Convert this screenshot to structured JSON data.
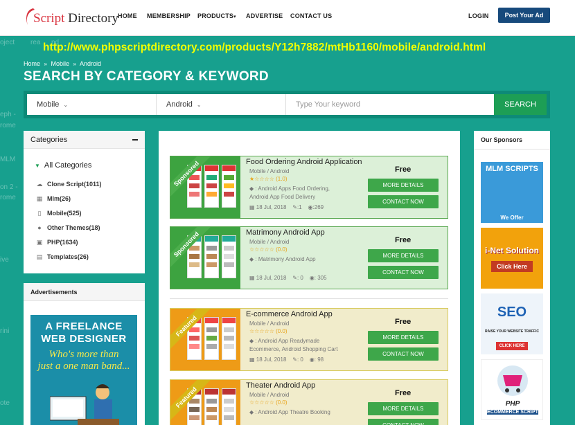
{
  "logo": {
    "brand": "Script",
    "brand_rest": " Directory"
  },
  "nav": {
    "home": "HOME",
    "membership": "MEMBERSHIP",
    "products": "PRODUCTS",
    "advertise": "ADVERTISE",
    "contact": "CONTACT US",
    "login": "LOGIN",
    "post_ad": "Post Your Ad"
  },
  "url": "http://www.phpscriptdirectory.com/products/Y12h7882/mtHb1160/mobile/android.html",
  "ghost": {
    "a": "oject",
    "b": "rea",
    "c": "nd",
    "d": "eph -",
    "e": "rome",
    "f": "MLM",
    "g": "on 2 -",
    "h": "rome",
    "i": "ive",
    "j": "rini",
    "k": "ote"
  },
  "breadcrumb": {
    "home": "Home",
    "mobile": "Mobile",
    "android": "Android"
  },
  "title": "SEARCH BY CATEGORY & KEYWORD",
  "search": {
    "category": "Mobile",
    "subcategory": "Android",
    "placeholder": "Type Your keyword",
    "button": "SEARCH"
  },
  "categories": {
    "heading": "Categories",
    "all": "All Categories",
    "items": [
      {
        "label": "Clone Script(1011)",
        "icon": "cloud-icon"
      },
      {
        "label": "Mlm(26)",
        "icon": "hierarchy-icon"
      },
      {
        "label": "Mobile(525)",
        "icon": "mobile-icon"
      },
      {
        "label": "Other Themes(18)",
        "icon": "info-icon"
      },
      {
        "label": "PHP(1634)",
        "icon": "code-icon"
      },
      {
        "label": "Templates(26)",
        "icon": "document-icon"
      }
    ]
  },
  "advertisements": {
    "heading": "Advertisements",
    "line1": "A FREELANCE",
    "line2": "WEB DESIGNER",
    "line3": "Who's more than",
    "line4": "just a one man band..."
  },
  "listings": [
    {
      "title": "Food Ordering Android Application",
      "category": "Mobile / Android",
      "rating": "(1.0)",
      "tags_label": ": Android Apps Food Ordering,",
      "tags_more": "Android App Food Delivery",
      "date": "18 Jul, 2018",
      "comments": ":1",
      "views": ":269",
      "price": "Free",
      "badge": "Sponsored",
      "more": "MORE DETAILS",
      "contact": "CONTACT NOW"
    },
    {
      "title": "Matrimony Android App",
      "category": "Mobile / Android",
      "rating": "(0.0)",
      "tags_label": ": Matrimony Android App",
      "tags_more": "",
      "date": "18 Jul, 2018",
      "comments": ": 0",
      "views": ": 305",
      "price": "Free",
      "badge": "Sponsored",
      "more": "MORE DETAILS",
      "contact": "CONTACT NOW"
    },
    {
      "title": "E-commerce Android App",
      "category": "Mobile / Android",
      "rating": "(0.0)",
      "tags_label": ": Android App Readymade",
      "tags_more": "Ecommerce, Android Shopping Cart",
      "date": "18 Jul, 2018",
      "comments": ": 0",
      "views": ": 98",
      "price": "Free",
      "badge": "Featured",
      "more": "MORE DETAILS",
      "contact": "CONTACT NOW"
    },
    {
      "title": "Theater Android App",
      "category": "Mobile / Android",
      "rating": "(0.0)",
      "tags_label": ": Android App Theatre Booking",
      "tags_more": "",
      "date": "",
      "comments": "",
      "views": "",
      "price": "Free",
      "badge": "Featured",
      "more": "MORE DETAILS",
      "contact": "CONTACT NOW"
    }
  ],
  "sponsors": {
    "heading": "Our Sponsors",
    "ad1": {
      "title": "MLM SCRIPTS",
      "sub": "We Offer"
    },
    "ad2": {
      "title": "i-Net Solution",
      "button": "Click Here"
    },
    "ad3": {
      "title": "SEO",
      "sub": "RAISE YOUR WEBSITE TRAFFIC",
      "button": "CLICK HERE"
    },
    "ad4": {
      "title": "PHP",
      "sub": "ECOMMERCE SCRIPT"
    }
  },
  "colors": {
    "teal": "#17a08e",
    "navy": "#174a7c",
    "green": "#3ea74a",
    "url_yellow": "#f2ff00"
  }
}
